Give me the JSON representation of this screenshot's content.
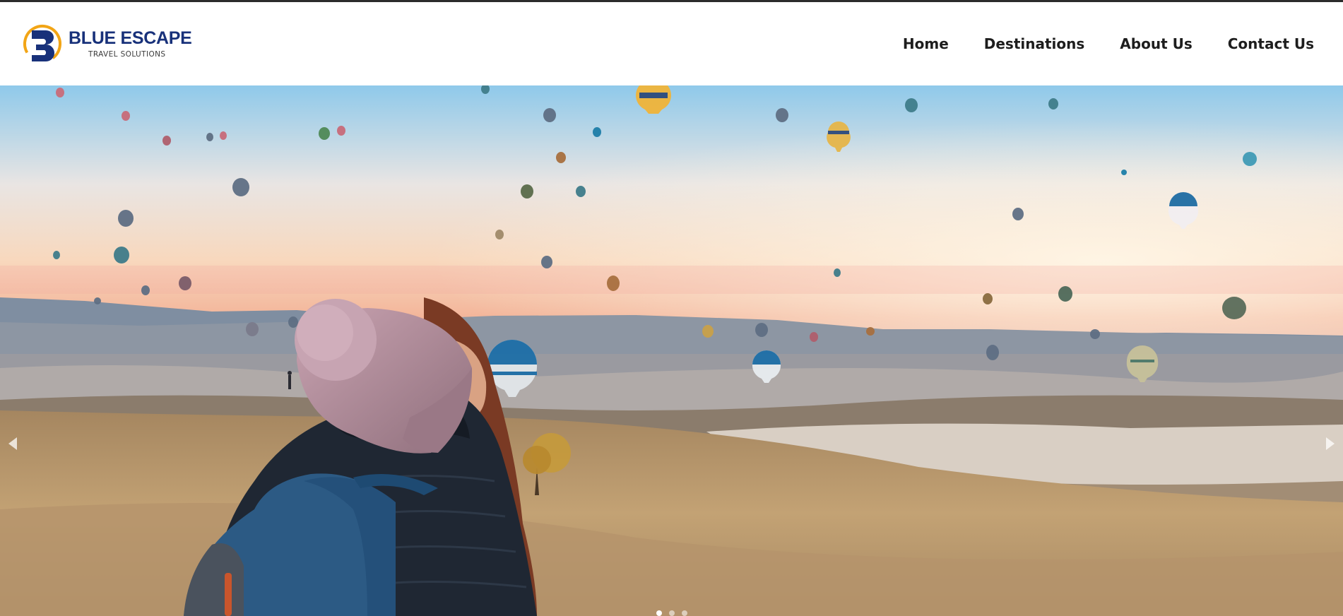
{
  "brand": {
    "name": "BLUE ESCAPE",
    "tagline": "TRAVEL SOLUTIONS",
    "colors": {
      "primary": "#18317a",
      "accent": "#f2a516"
    }
  },
  "nav": {
    "items": [
      {
        "label": "Home"
      },
      {
        "label": "Destinations"
      },
      {
        "label": "About Us"
      },
      {
        "label": "Contact Us"
      }
    ]
  },
  "hero": {
    "image": "hot-air-balloons-cappadocia-traveler-photo",
    "slider": {
      "prev_icon": "chevron-left-icon",
      "next_icon": "chevron-right-icon",
      "active_slide": 1
    }
  }
}
